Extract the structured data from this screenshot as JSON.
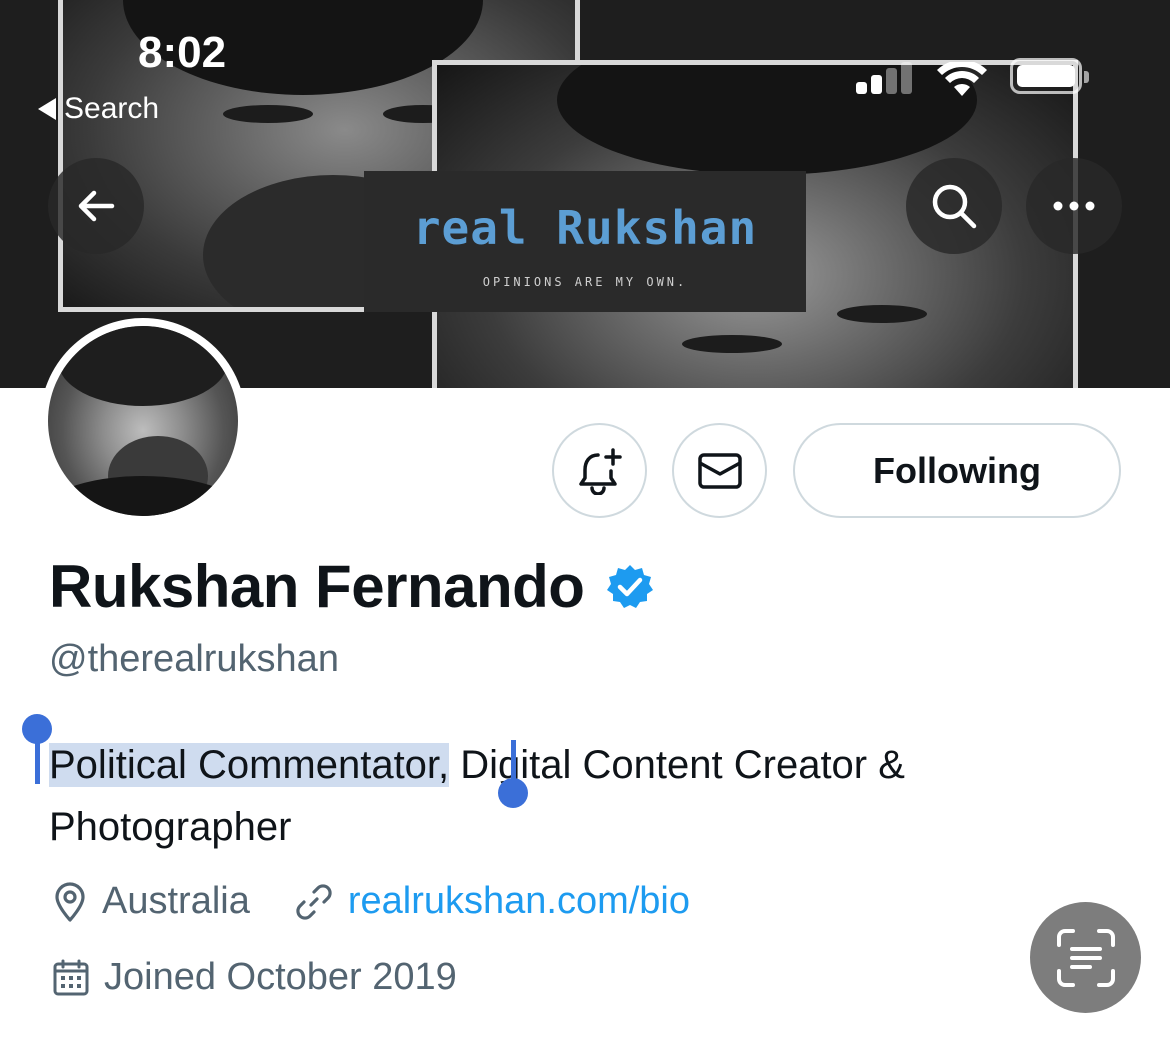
{
  "status_bar": {
    "time": "8:02",
    "back_app_label": "Search"
  },
  "banner": {
    "title": "real Rukshan",
    "tagline": "OPINIONS ARE MY OWN."
  },
  "header_icons": {
    "back": "arrow-left-icon",
    "search": "search-icon",
    "more": "more-horizontal-icon"
  },
  "actions": {
    "notify_icon": "bell-plus-icon",
    "message_icon": "envelope-icon",
    "follow_label": "Following"
  },
  "profile": {
    "display_name": "Rukshan Fernando",
    "verified": true,
    "handle": "@therealrukshan",
    "bio_selected": "Political Commentator,",
    "bio_rest_line1": " Digital Content Creator &",
    "bio_line2": "Photographer",
    "location": "Australia",
    "website": "realrukshan.com/bio",
    "joined": "Joined October 2019"
  },
  "colors": {
    "accent": "#1d9bf0",
    "verified": "#1d9bf0",
    "secondary_text": "#536471",
    "selection": "#cfdcef",
    "selection_handle": "#3b6fd8"
  },
  "floating": {
    "scan_icon": "text-scan-icon"
  }
}
